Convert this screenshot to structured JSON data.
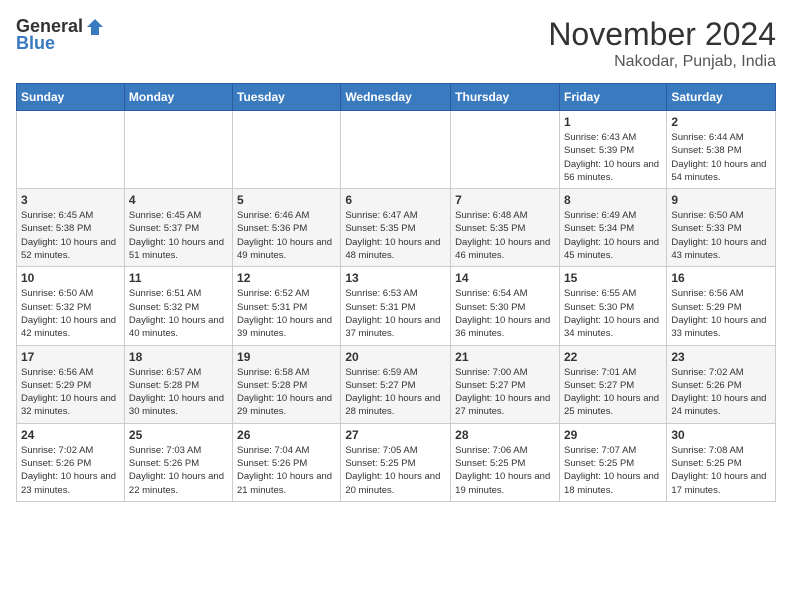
{
  "header": {
    "logo_general": "General",
    "logo_blue": "Blue",
    "month_title": "November 2024",
    "location": "Nakodar, Punjab, India"
  },
  "weekdays": [
    "Sunday",
    "Monday",
    "Tuesday",
    "Wednesday",
    "Thursday",
    "Friday",
    "Saturday"
  ],
  "weeks": [
    [
      {
        "day": "",
        "info": ""
      },
      {
        "day": "",
        "info": ""
      },
      {
        "day": "",
        "info": ""
      },
      {
        "day": "",
        "info": ""
      },
      {
        "day": "",
        "info": ""
      },
      {
        "day": "1",
        "info": "Sunrise: 6:43 AM\nSunset: 5:39 PM\nDaylight: 10 hours and 56 minutes."
      },
      {
        "day": "2",
        "info": "Sunrise: 6:44 AM\nSunset: 5:38 PM\nDaylight: 10 hours and 54 minutes."
      }
    ],
    [
      {
        "day": "3",
        "info": "Sunrise: 6:45 AM\nSunset: 5:38 PM\nDaylight: 10 hours and 52 minutes."
      },
      {
        "day": "4",
        "info": "Sunrise: 6:45 AM\nSunset: 5:37 PM\nDaylight: 10 hours and 51 minutes."
      },
      {
        "day": "5",
        "info": "Sunrise: 6:46 AM\nSunset: 5:36 PM\nDaylight: 10 hours and 49 minutes."
      },
      {
        "day": "6",
        "info": "Sunrise: 6:47 AM\nSunset: 5:35 PM\nDaylight: 10 hours and 48 minutes."
      },
      {
        "day": "7",
        "info": "Sunrise: 6:48 AM\nSunset: 5:35 PM\nDaylight: 10 hours and 46 minutes."
      },
      {
        "day": "8",
        "info": "Sunrise: 6:49 AM\nSunset: 5:34 PM\nDaylight: 10 hours and 45 minutes."
      },
      {
        "day": "9",
        "info": "Sunrise: 6:50 AM\nSunset: 5:33 PM\nDaylight: 10 hours and 43 minutes."
      }
    ],
    [
      {
        "day": "10",
        "info": "Sunrise: 6:50 AM\nSunset: 5:32 PM\nDaylight: 10 hours and 42 minutes."
      },
      {
        "day": "11",
        "info": "Sunrise: 6:51 AM\nSunset: 5:32 PM\nDaylight: 10 hours and 40 minutes."
      },
      {
        "day": "12",
        "info": "Sunrise: 6:52 AM\nSunset: 5:31 PM\nDaylight: 10 hours and 39 minutes."
      },
      {
        "day": "13",
        "info": "Sunrise: 6:53 AM\nSunset: 5:31 PM\nDaylight: 10 hours and 37 minutes."
      },
      {
        "day": "14",
        "info": "Sunrise: 6:54 AM\nSunset: 5:30 PM\nDaylight: 10 hours and 36 minutes."
      },
      {
        "day": "15",
        "info": "Sunrise: 6:55 AM\nSunset: 5:30 PM\nDaylight: 10 hours and 34 minutes."
      },
      {
        "day": "16",
        "info": "Sunrise: 6:56 AM\nSunset: 5:29 PM\nDaylight: 10 hours and 33 minutes."
      }
    ],
    [
      {
        "day": "17",
        "info": "Sunrise: 6:56 AM\nSunset: 5:29 PM\nDaylight: 10 hours and 32 minutes."
      },
      {
        "day": "18",
        "info": "Sunrise: 6:57 AM\nSunset: 5:28 PM\nDaylight: 10 hours and 30 minutes."
      },
      {
        "day": "19",
        "info": "Sunrise: 6:58 AM\nSunset: 5:28 PM\nDaylight: 10 hours and 29 minutes."
      },
      {
        "day": "20",
        "info": "Sunrise: 6:59 AM\nSunset: 5:27 PM\nDaylight: 10 hours and 28 minutes."
      },
      {
        "day": "21",
        "info": "Sunrise: 7:00 AM\nSunset: 5:27 PM\nDaylight: 10 hours and 27 minutes."
      },
      {
        "day": "22",
        "info": "Sunrise: 7:01 AM\nSunset: 5:27 PM\nDaylight: 10 hours and 25 minutes."
      },
      {
        "day": "23",
        "info": "Sunrise: 7:02 AM\nSunset: 5:26 PM\nDaylight: 10 hours and 24 minutes."
      }
    ],
    [
      {
        "day": "24",
        "info": "Sunrise: 7:02 AM\nSunset: 5:26 PM\nDaylight: 10 hours and 23 minutes."
      },
      {
        "day": "25",
        "info": "Sunrise: 7:03 AM\nSunset: 5:26 PM\nDaylight: 10 hours and 22 minutes."
      },
      {
        "day": "26",
        "info": "Sunrise: 7:04 AM\nSunset: 5:26 PM\nDaylight: 10 hours and 21 minutes."
      },
      {
        "day": "27",
        "info": "Sunrise: 7:05 AM\nSunset: 5:25 PM\nDaylight: 10 hours and 20 minutes."
      },
      {
        "day": "28",
        "info": "Sunrise: 7:06 AM\nSunset: 5:25 PM\nDaylight: 10 hours and 19 minutes."
      },
      {
        "day": "29",
        "info": "Sunrise: 7:07 AM\nSunset: 5:25 PM\nDaylight: 10 hours and 18 minutes."
      },
      {
        "day": "30",
        "info": "Sunrise: 7:08 AM\nSunset: 5:25 PM\nDaylight: 10 hours and 17 minutes."
      }
    ]
  ]
}
